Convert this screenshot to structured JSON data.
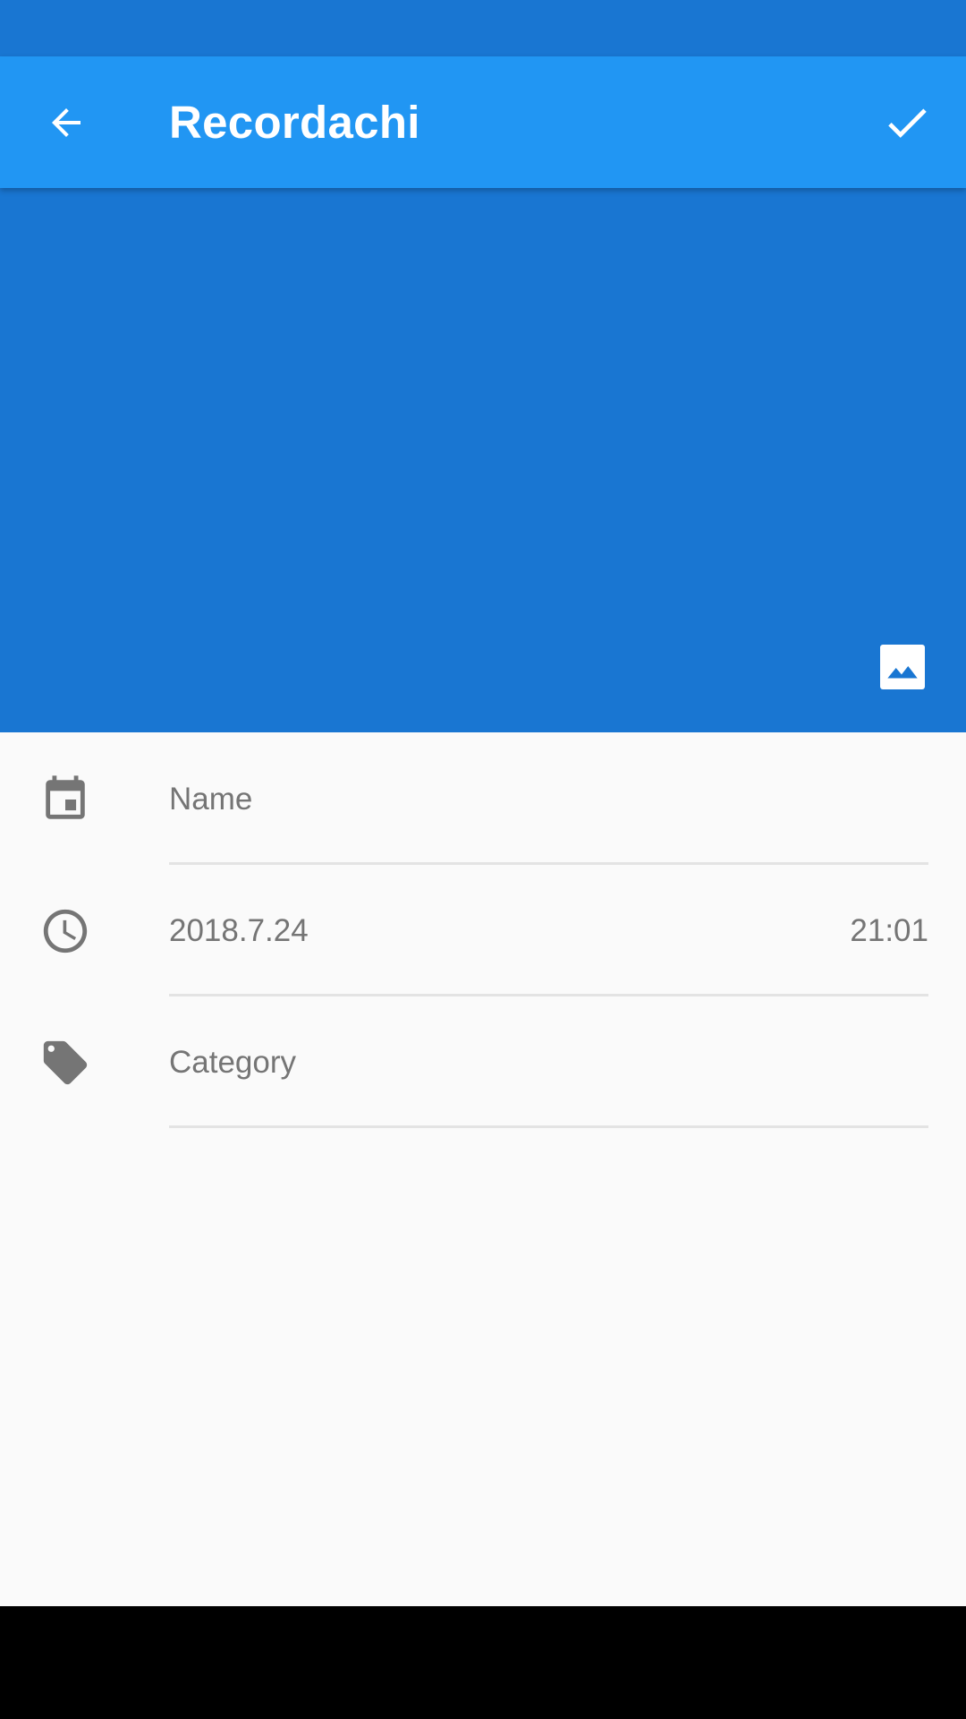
{
  "app_bar": {
    "title": "Recordachi",
    "back_icon": "arrow-back-icon",
    "confirm_icon": "check-icon"
  },
  "header_image": {
    "image_icon": "image-icon"
  },
  "form": {
    "name": {
      "icon": "calendar-icon",
      "placeholder": "Name"
    },
    "datetime": {
      "icon": "clock-icon",
      "date": "2018.7.24",
      "time": "21:01"
    },
    "category": {
      "icon": "tag-icon",
      "placeholder": "Category"
    }
  },
  "colors": {
    "status_bar": "#1976d2",
    "app_bar": "#2196f3",
    "header_image": "#1976d2",
    "icon_gray": "#757575",
    "background": "#fafafa"
  }
}
